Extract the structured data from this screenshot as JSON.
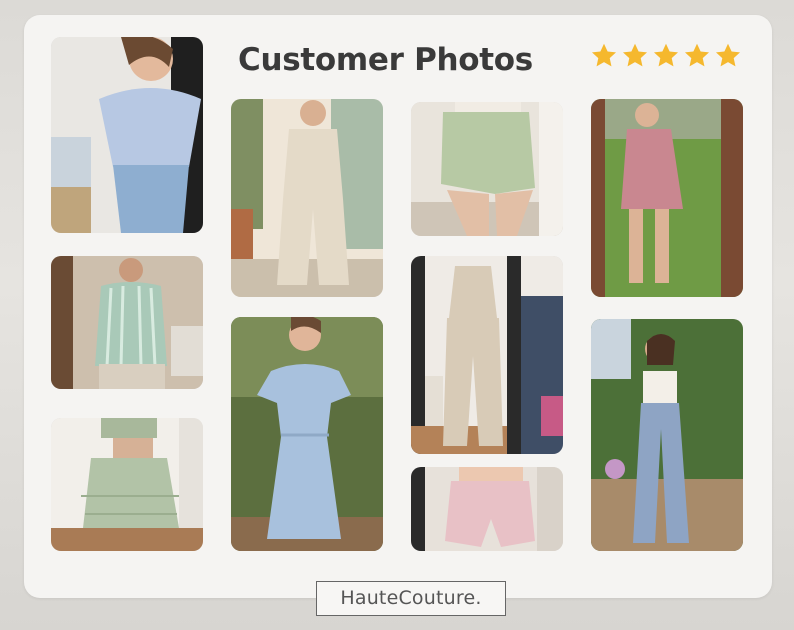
{
  "header": {
    "title": "Customer Photos",
    "rating": 5,
    "star_color": "#f5b82e"
  },
  "brand": {
    "label": "HauteCouture."
  },
  "photos": [
    {
      "name": "photo-blue-wrap-top-jeans",
      "column": 1,
      "row": 1
    },
    {
      "name": "photo-striped-shirt-man",
      "column": 1,
      "row": 2
    },
    {
      "name": "photo-sage-smocked-skirt-set",
      "column": 1,
      "row": 3
    },
    {
      "name": "photo-linen-jumpsuit",
      "column": 2,
      "row": 1
    },
    {
      "name": "photo-blue-flutter-dress",
      "column": 2,
      "row": 2
    },
    {
      "name": "photo-sage-wrap-shorts",
      "column": 3,
      "row": 1
    },
    {
      "name": "photo-striped-peplum-pants-set",
      "column": 3,
      "row": 2
    },
    {
      "name": "photo-pink-striped-shorts",
      "column": 3,
      "row": 3
    },
    {
      "name": "photo-pink-overall-shorts",
      "column": 4,
      "row": 1
    },
    {
      "name": "photo-blue-linen-pants",
      "column": 4,
      "row": 2
    }
  ]
}
